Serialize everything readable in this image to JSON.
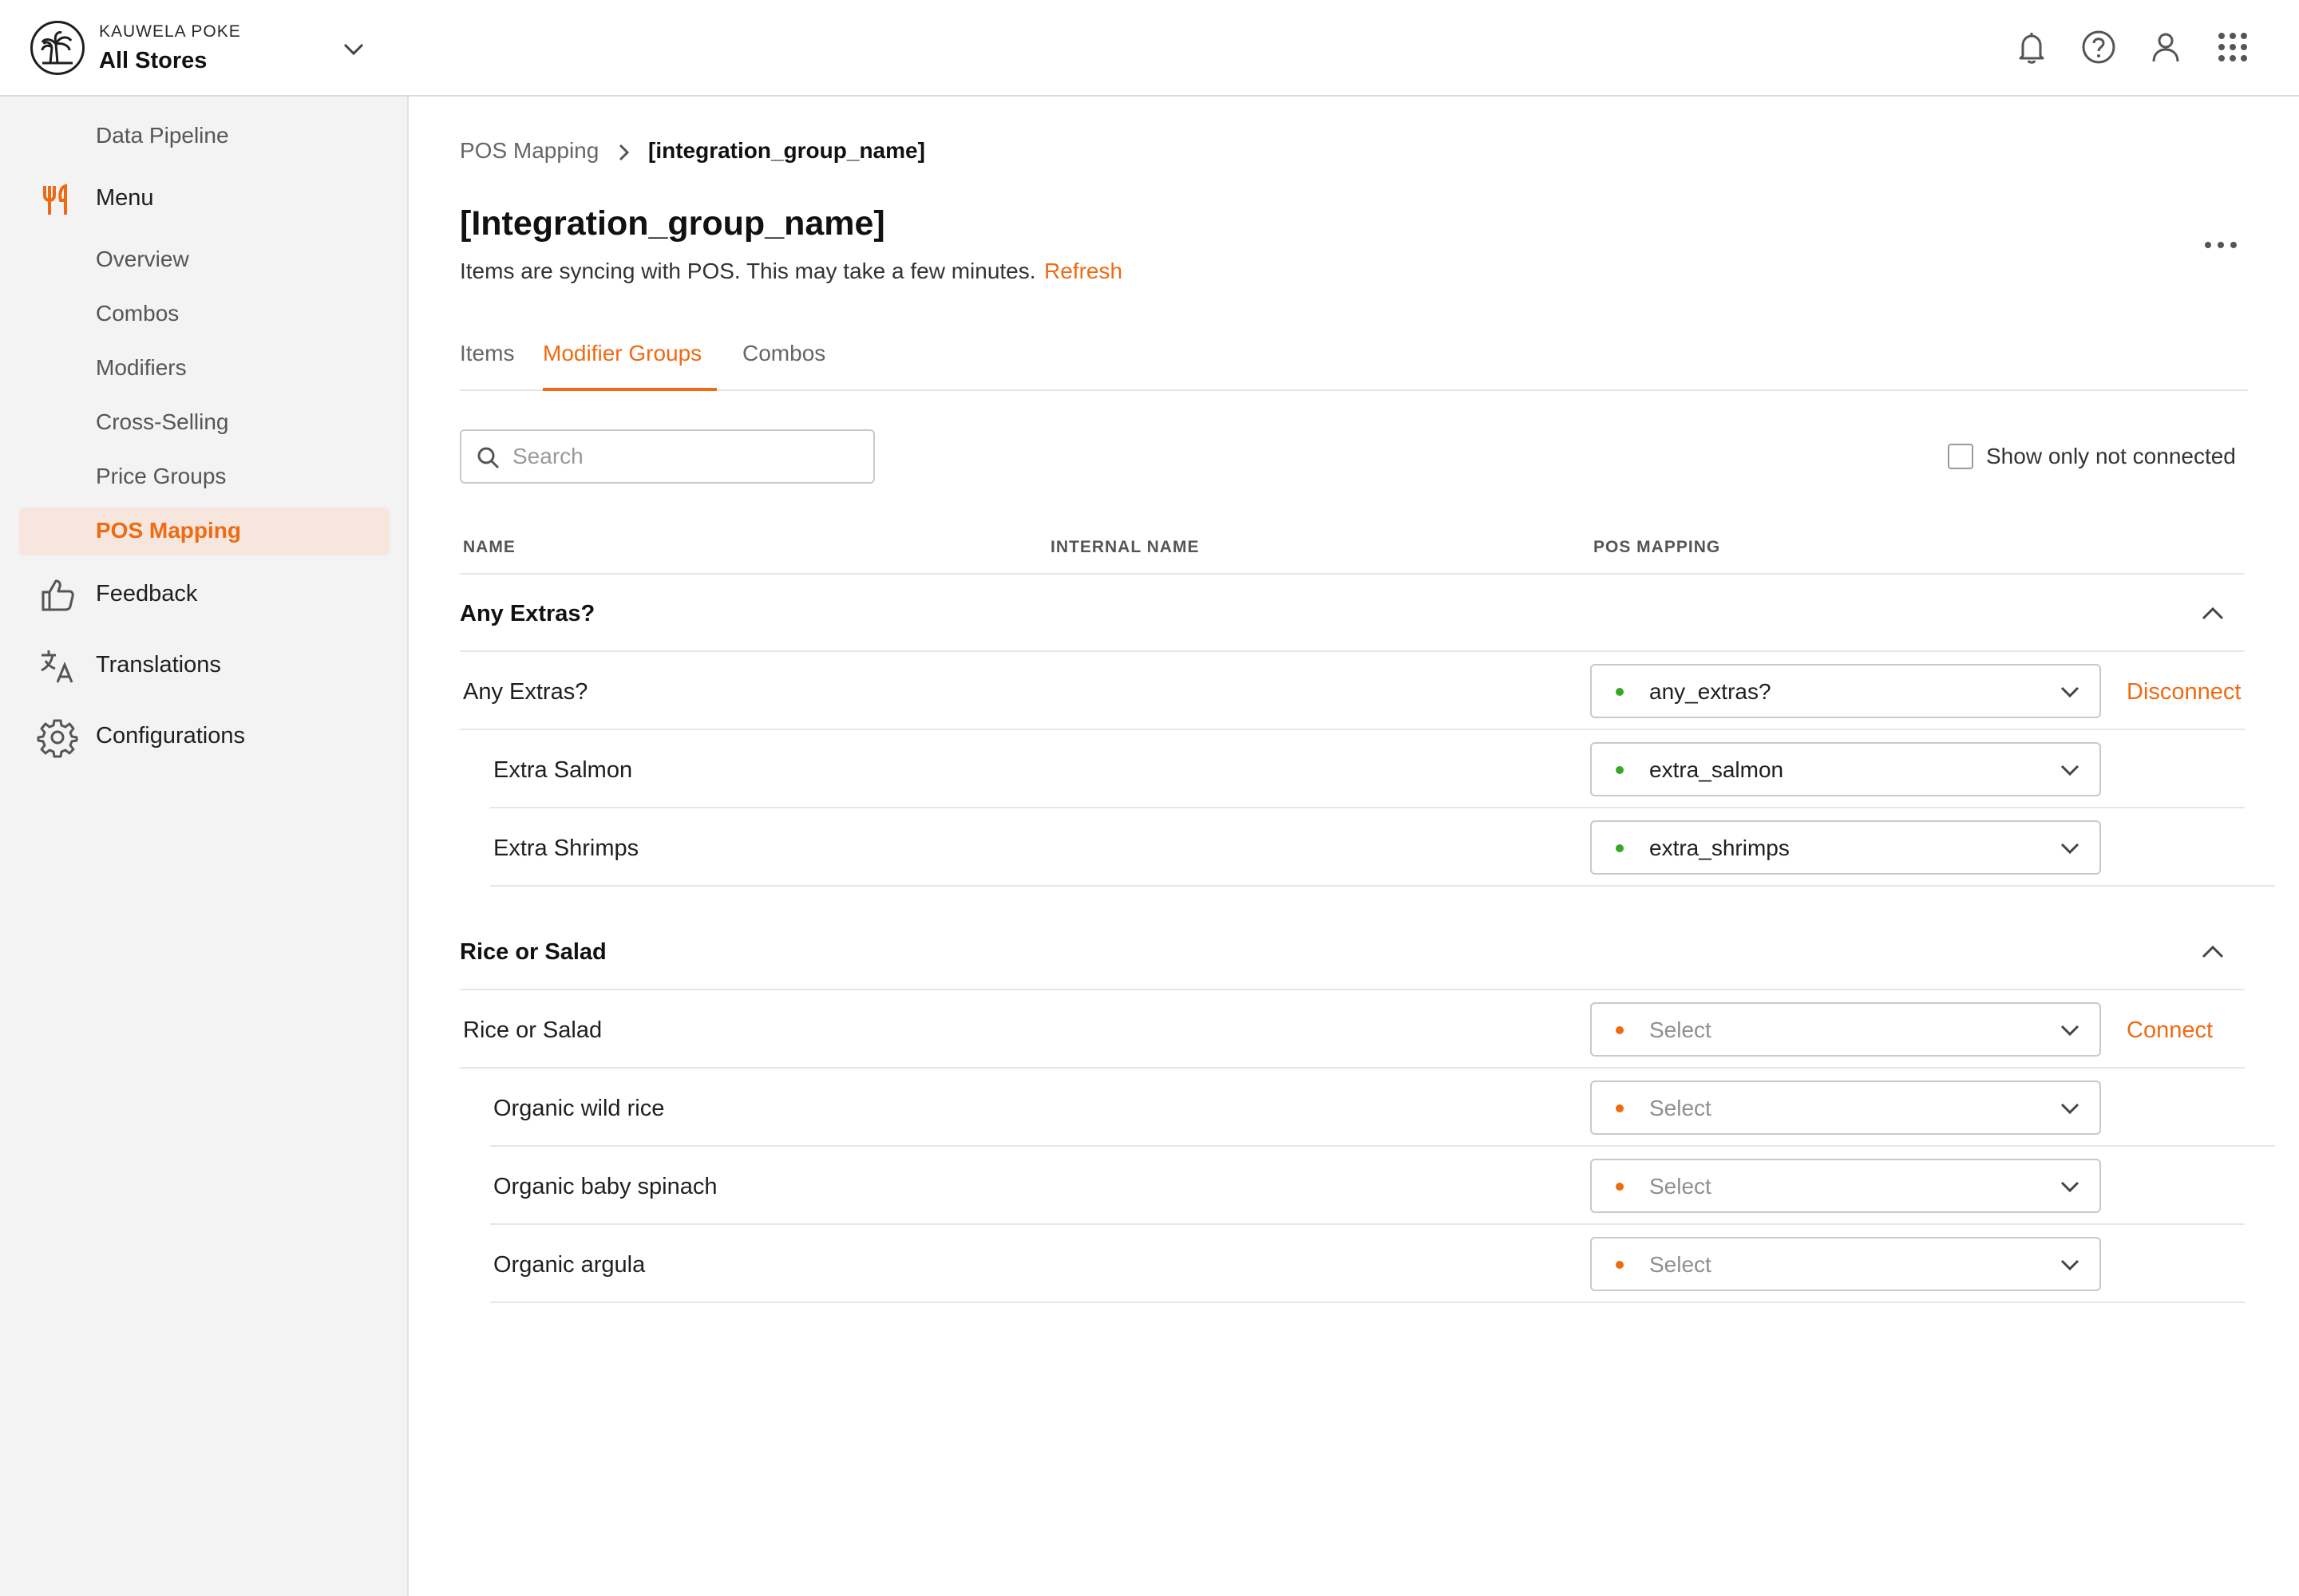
{
  "header": {
    "org_name": "KAUWELA POKE",
    "store_name": "All Stores",
    "icons": [
      "logo-palm-icon",
      "chevron-down-icon",
      "bell-icon",
      "help-icon",
      "user-icon",
      "apps-grid-icon"
    ]
  },
  "sidebar": {
    "items": [
      {
        "label": "Data Pipeline",
        "type": "sub"
      },
      {
        "label": "Menu",
        "type": "main",
        "icon": "fork-knife-icon"
      },
      {
        "label": "Overview",
        "type": "sub"
      },
      {
        "label": "Combos",
        "type": "sub"
      },
      {
        "label": "Modifiers",
        "type": "sub"
      },
      {
        "label": "Cross-Selling",
        "type": "sub"
      },
      {
        "label": "Price Groups",
        "type": "sub"
      },
      {
        "label": "POS Mapping",
        "type": "sub",
        "active": true
      },
      {
        "label": "Feedback",
        "type": "main",
        "icon": "thumbs-up-icon"
      },
      {
        "label": "Translations",
        "type": "main",
        "icon": "translate-icon"
      },
      {
        "label": "Configurations",
        "type": "main",
        "icon": "gear-icon"
      }
    ]
  },
  "breadcrumb": {
    "parent": "POS Mapping",
    "current": "[integration_group_name]"
  },
  "page": {
    "title": "[Integration_group_name]",
    "sync_message": "Items are syncing with POS. This may take a few minutes.",
    "refresh_label": "Refresh"
  },
  "tabs": [
    {
      "label": "Items",
      "active": false
    },
    {
      "label": "Modifier Groups",
      "active": true
    },
    {
      "label": "Combos",
      "active": false
    }
  ],
  "search": {
    "placeholder": "Search",
    "value": ""
  },
  "filter": {
    "label": "Show only not connected",
    "checked": false
  },
  "table": {
    "columns": [
      "NAME",
      "INTERNAL NAME",
      "POS MAPPING"
    ],
    "groups": [
      {
        "title": "Any Extras?",
        "parent": {
          "name": "Any Extras?",
          "mapping": "any_extras?",
          "status": "connected",
          "action": "Disconnect"
        },
        "children": [
          {
            "name": "Extra Salmon",
            "mapping": "extra_salmon",
            "status": "connected"
          },
          {
            "name": "Extra Shrimps",
            "mapping": "extra_shrimps",
            "status": "connected"
          }
        ]
      },
      {
        "title": "Rice or Salad",
        "parent": {
          "name": "Rice or Salad",
          "mapping": "Select",
          "status": "not_connected",
          "action": "Connect"
        },
        "children": [
          {
            "name": "Organic wild rice",
            "mapping": "Select",
            "status": "not_connected"
          },
          {
            "name": "Organic baby spinach",
            "mapping": "Select",
            "status": "not_connected"
          },
          {
            "name": "Organic argula",
            "mapping": "Select",
            "status": "not_connected"
          }
        ]
      }
    ]
  },
  "colors": {
    "accent": "#ef6a11",
    "connected_dot": "#3aa627",
    "not_connected_dot": "#ef6a11",
    "active_nav_bg": "#f7e6dd"
  }
}
